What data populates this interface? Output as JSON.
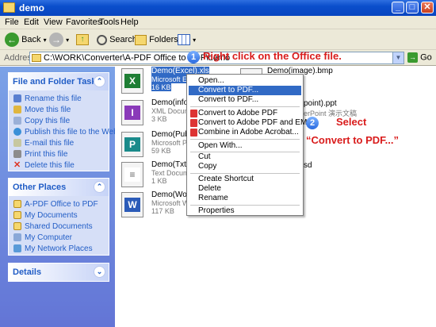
{
  "window": {
    "title": "demo",
    "min": "_",
    "max": "□",
    "close": "✕"
  },
  "menu": [
    "File",
    "Edit",
    "View",
    "Favorites",
    "Tools",
    "Help"
  ],
  "toolbar": {
    "back": "Back",
    "search": "Search",
    "folders": "Folders"
  },
  "address": {
    "label": "Address",
    "path": "C:\\WORK\\Converter\\A-PDF Office to PDF\\demo",
    "go": "Go"
  },
  "file_tasks": {
    "title": "File and Folder Tasks",
    "items": [
      "Rename this file",
      "Move this file",
      "Copy this file",
      "Publish this file to the Web",
      "E-mail this file",
      "Print this file",
      "Delete this file"
    ]
  },
  "other_places": {
    "title": "Other Places",
    "items": [
      "A-PDF Office to PDF",
      "My Documents",
      "Shared Documents",
      "My Computer",
      "My Network Places"
    ]
  },
  "details": {
    "title": "Details"
  },
  "files": [
    {
      "name": "Demo(Excel).xls",
      "type": "Microsoft Excel",
      "size": "16 KB",
      "badge": "X",
      "color": "#1e7e34"
    },
    {
      "name": "Demo(infopath",
      "type": "XML Document",
      "size": "3 KB",
      "badge": "I",
      "color": "#8a3ab9"
    },
    {
      "name": "Demo(Publishe",
      "type": "Microsoft Pub",
      "size": "59 KB",
      "badge": "P",
      "color": "#1a8a8a"
    },
    {
      "name": "Demo(Txt).txt",
      "type": "Text Documer",
      "size": "1 KB",
      "badge": "≡",
      "color": "#666666"
    },
    {
      "name": "Demo(Word).c",
      "type": "Microsoft Wor",
      "size": "117 KB",
      "badge": "W",
      "color": "#2b5bb8"
    }
  ],
  "right_files": [
    {
      "name": "Demo(image).bmp",
      "type": "PDFFile.10"
    },
    {
      "name": "point).ppt",
      "type": "erPoint 演示文稿"
    },
    {
      "name": "sd",
      "type": ""
    }
  ],
  "context_menu": [
    "Open...",
    "Convert to PDF...",
    "Convert to PDF...",
    "Convert to Adobe PDF",
    "Convert to Adobe PDF and EMail",
    "Combine in Adobe Acrobat...",
    "Open With...",
    "Cut",
    "Copy",
    "Create Shortcut",
    "Delete",
    "Rename",
    "Properties"
  ],
  "annotations": {
    "step1_num": "1",
    "step1_text": "Right click on the Office file.",
    "step2_num": "2",
    "step2_text": "Select",
    "step2_sub": "“Convert to PDF...”"
  }
}
